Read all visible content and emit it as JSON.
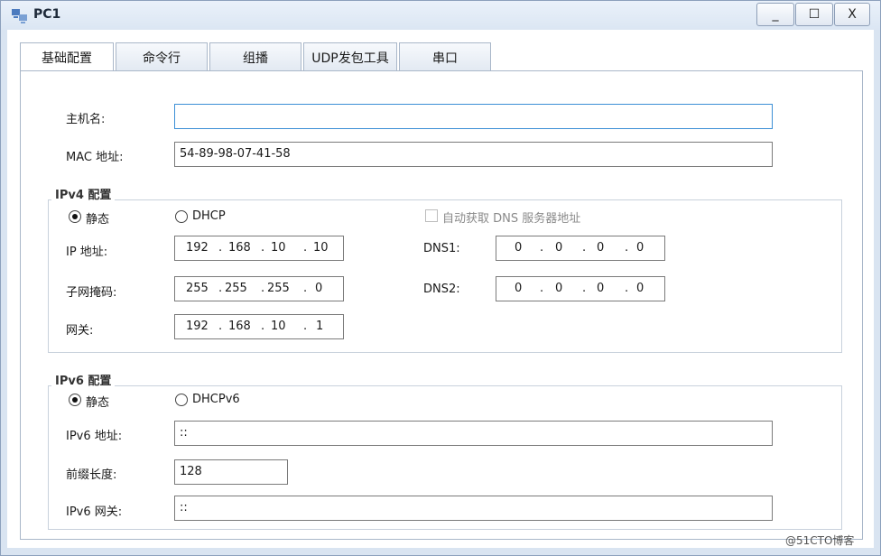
{
  "window": {
    "title": "PC1",
    "min_label": "_",
    "max_label": "☐",
    "close_label": "X"
  },
  "tabs": [
    "基础配置",
    "命令行",
    "组播",
    "UDP发包工具",
    "串口"
  ],
  "basic": {
    "hostname_label": "主机名:",
    "hostname_value": "",
    "mac_label": "MAC 地址:",
    "mac_value": "54-89-98-07-41-58"
  },
  "ipv4": {
    "group_title": "IPv4 配置",
    "static_label": "静态",
    "dhcp_label": "DHCP",
    "auto_dns_label": "自动获取 DNS 服务器地址",
    "ip_label": "IP 地址:",
    "ip": [
      "192",
      "168",
      "10",
      "10"
    ],
    "mask_label": "子网掩码:",
    "mask": [
      "255",
      "255",
      "255",
      "0"
    ],
    "gateway_label": "网关:",
    "gateway": [
      "192",
      "168",
      "10",
      "1"
    ],
    "dns1_label": "DNS1:",
    "dns1": [
      "0",
      "0",
      "0",
      "0"
    ],
    "dns2_label": "DNS2:",
    "dns2": [
      "0",
      "0",
      "0",
      "0"
    ],
    "dot": "."
  },
  "ipv6": {
    "group_title": "IPv6 配置",
    "static_label": "静态",
    "dhcp_label": "DHCPv6",
    "ip_label": "IPv6 地址:",
    "ip_value": "::",
    "prefix_label": "前缀长度:",
    "prefix_value": "128",
    "gateway_label": "IPv6 网关:",
    "gateway_value": "::"
  },
  "watermark": "@51CTO博客"
}
